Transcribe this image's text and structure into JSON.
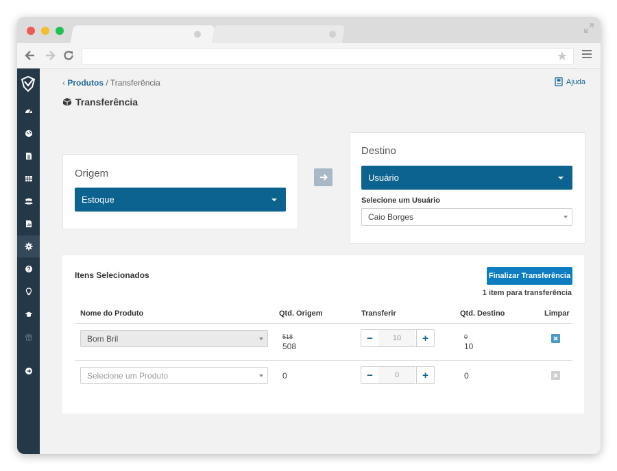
{
  "browser": {
    "url": ""
  },
  "breadcrumb": {
    "parent": "Produtos",
    "separator": "/",
    "current": "Transferência"
  },
  "help": {
    "label": "Ajuda"
  },
  "page": {
    "title": "Transferência"
  },
  "origem": {
    "title": "Origem",
    "selected": "Estoque"
  },
  "destino": {
    "title": "Destino",
    "selected": "Usuário",
    "user_label": "Selecione um Usuário",
    "user_value": "Caio Borges"
  },
  "items": {
    "title": "Itens Selecionados",
    "finalize_label": "Finalizar Transferência",
    "count_text": "1 item para transferência",
    "columns": [
      "Nome do Produto",
      "Qtd. Origem",
      "Transferir",
      "Qtd. Destino",
      "Limpar"
    ],
    "rows": [
      {
        "product": "Bom Bril",
        "origin_old": "518",
        "origin_new": "508",
        "transfer": "10",
        "dest_old": "0",
        "dest_new": "10"
      },
      {
        "product_placeholder": "Selecione um Produto",
        "origin": "0",
        "transfer": "0",
        "dest": "0"
      }
    ],
    "minus_symbol": "−",
    "plus_symbol": "+"
  },
  "colors": {
    "primary": "#0d6390",
    "button": "#0b7dc0",
    "sidebar": "#253847"
  },
  "sidebar": {
    "icons": [
      "dashboard-icon",
      "globe-icon",
      "document-icon",
      "table-icon",
      "users-icon",
      "report-icon",
      "gear-icon",
      "question-icon",
      "lightbulb-icon",
      "graduation-cap-icon",
      "gift-icon",
      "arrow-right-circle-icon"
    ]
  }
}
